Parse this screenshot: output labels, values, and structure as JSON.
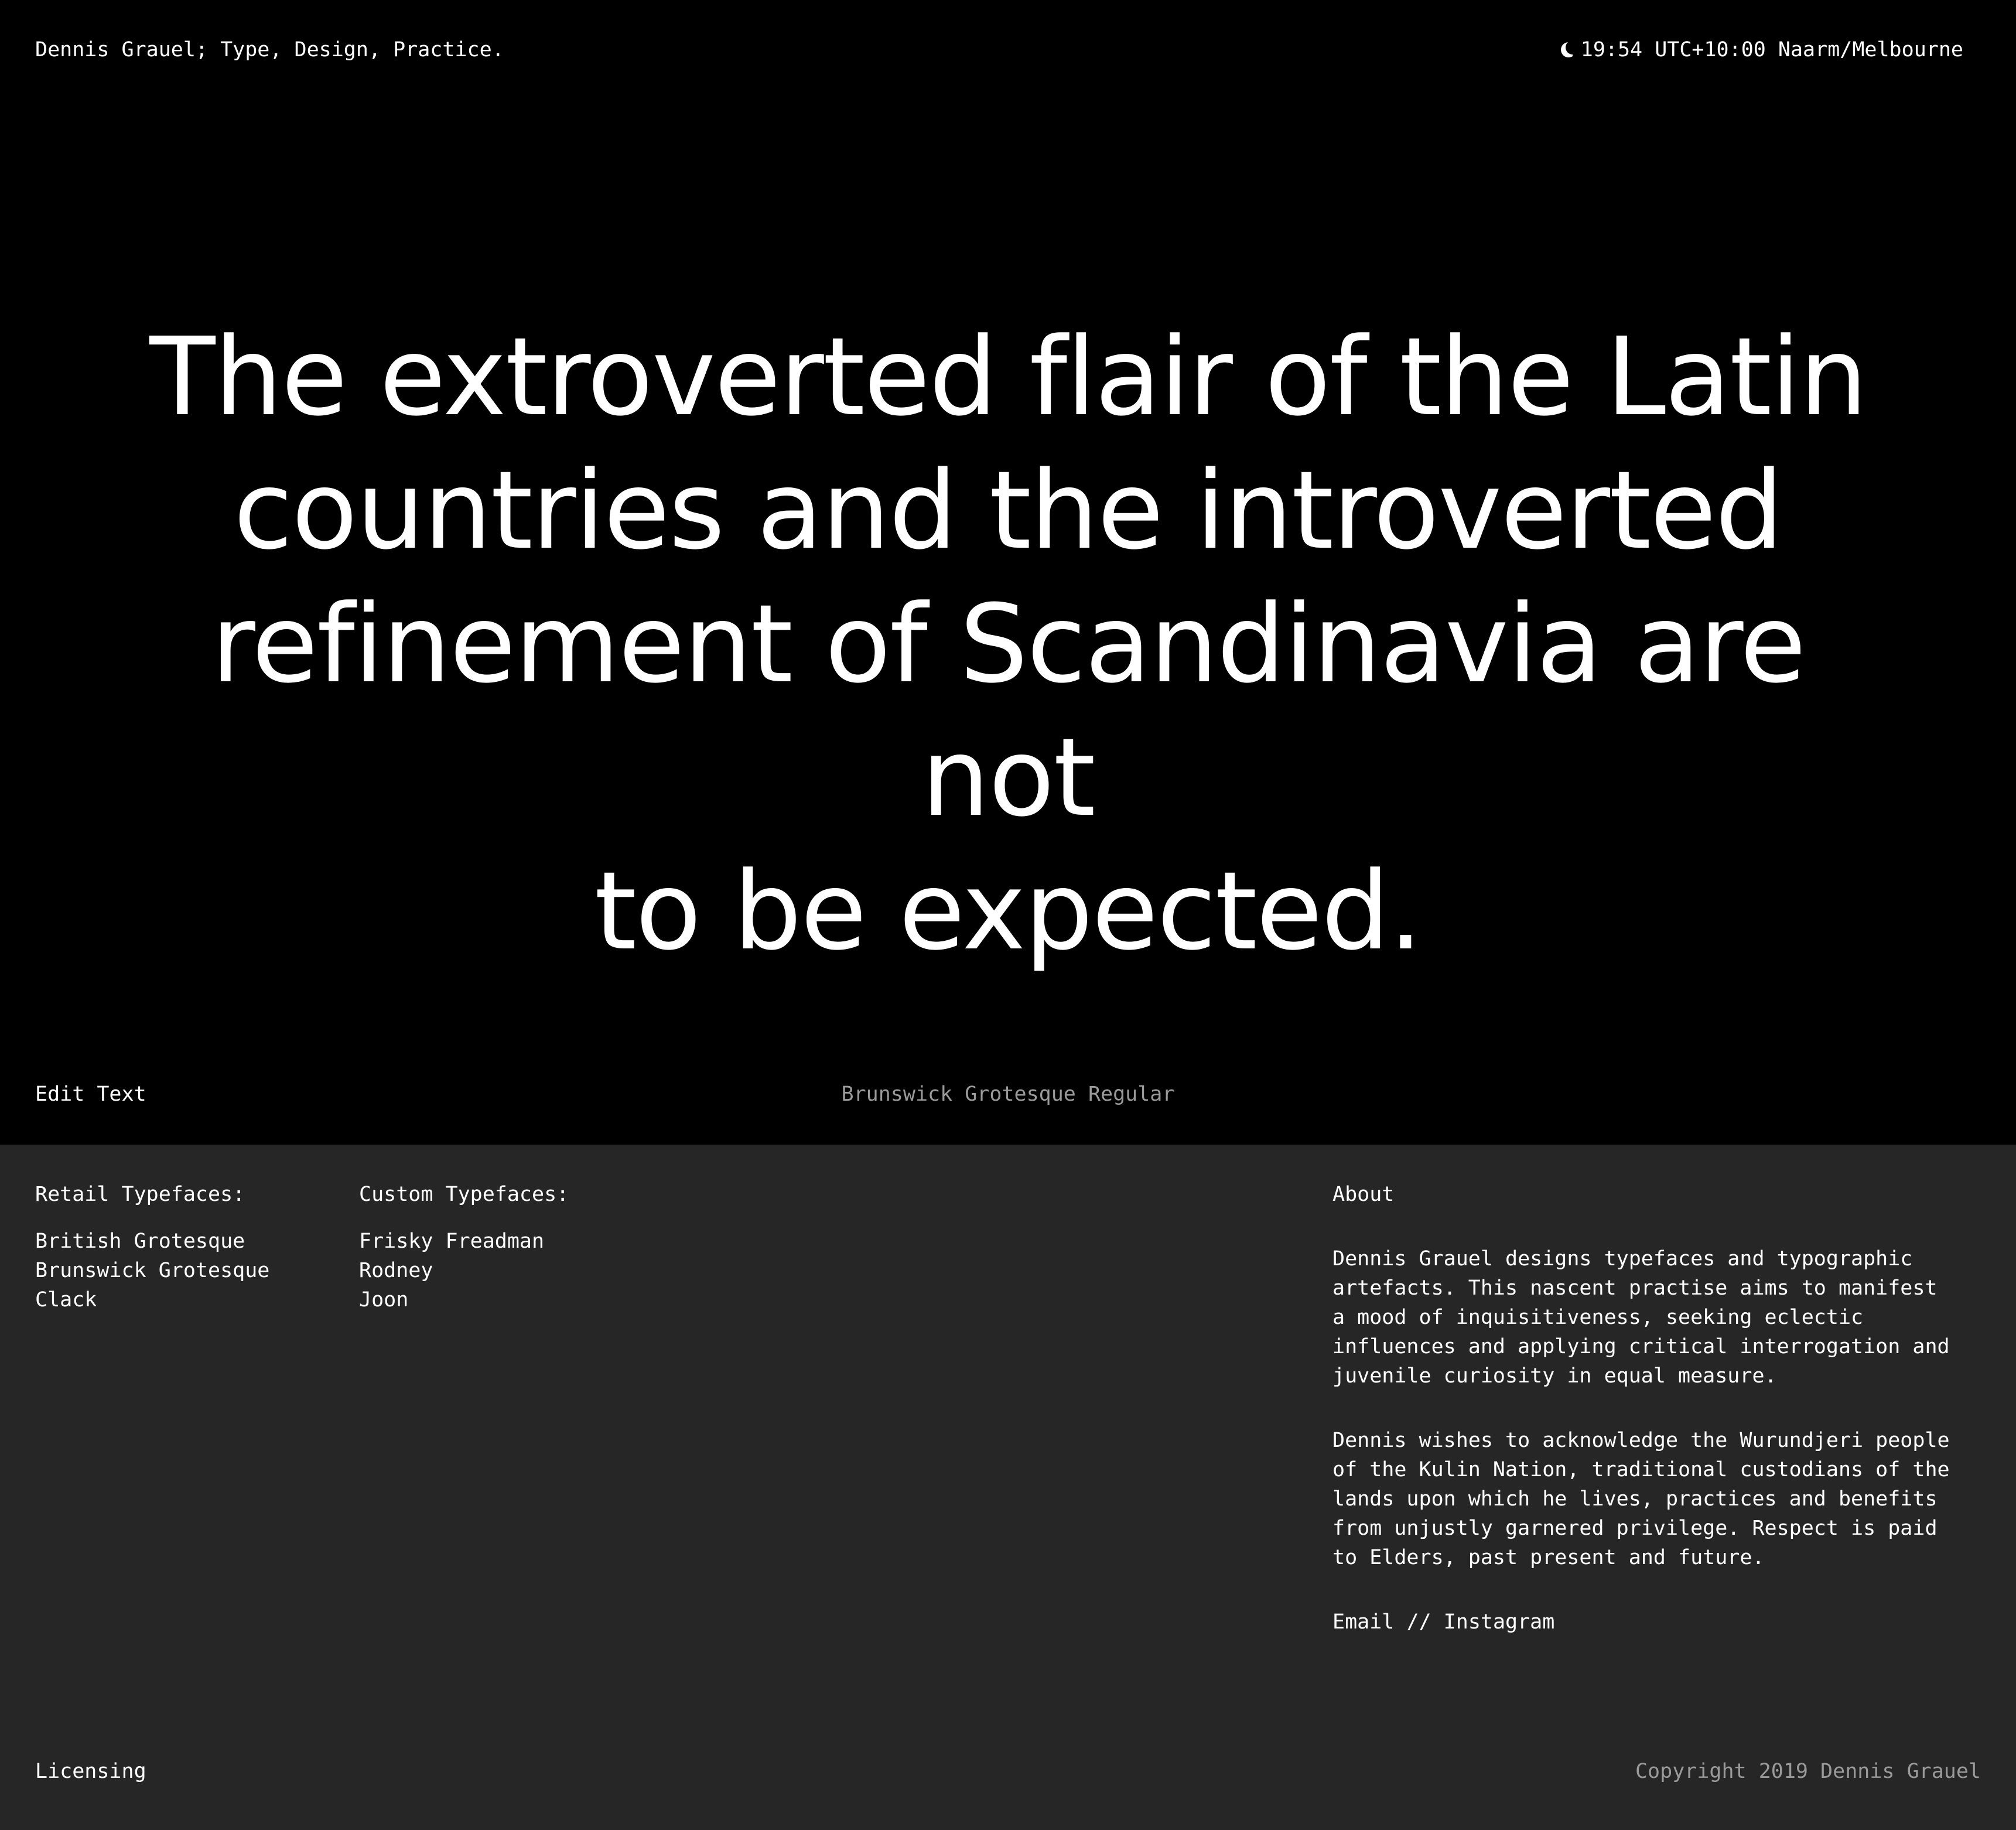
{
  "header": {
    "site_title": "Dennis Grauel; Type, Design, Practice.",
    "clock_icon": "moon-icon",
    "clock_text": "19:54 UTC+10:00 Naarm/Melbourne"
  },
  "specimen": {
    "line_1": "The extroverted flair of the Latin",
    "line_2": "countries and the introverted",
    "line_3": "refinement of Scandinavia are not",
    "line_4": "to be expected."
  },
  "controls": {
    "edit_text_label": "Edit Text",
    "font_name": "Brunswick Grotesque Regular"
  },
  "retail": {
    "heading": "Retail Typefaces:",
    "items": [
      {
        "label": "British Grotesque"
      },
      {
        "label": "Brunswick Grotesque"
      },
      {
        "label": "Clack"
      }
    ]
  },
  "custom": {
    "heading": "Custom Typefaces:",
    "items": [
      {
        "label": "Frisky Freadman"
      },
      {
        "label": "Rodney"
      },
      {
        "label": "Joon"
      }
    ]
  },
  "about": {
    "heading": "About",
    "paragraph_1": "Dennis Grauel designs typefaces and typographic artefacts. This nascent practise aims to manifest a mood of inquisitiveness, seeking eclectic influences and applying critical interrogation and juvenile curiosity in equal measure.",
    "paragraph_2": "Dennis wishes to acknowledge the Wurundjeri people of the Kulin Nation, traditional custodians of the lands upon which he lives, practices and benefits from unjustly garnered privilege. Respect is paid to Elders, past present and future.",
    "email_label": "Email",
    "separator": "//",
    "instagram_label": "Instagram"
  },
  "footer": {
    "licensing_label": "Licensing",
    "copyright": "Copyright 2019 Dennis Grauel"
  },
  "colors": {
    "hero_background": "#000000",
    "footer_background": "#262626",
    "text_primary": "#ffffff",
    "text_muted": "#9a9a9a"
  }
}
